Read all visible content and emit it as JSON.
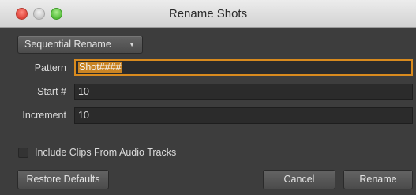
{
  "window": {
    "title": "Rename Shots"
  },
  "mode_dropdown": {
    "value": "Sequential Rename",
    "caret": "▼"
  },
  "fields": {
    "pattern": {
      "label": "Pattern",
      "value": "Shot####"
    },
    "start": {
      "label": "Start #",
      "value": "10"
    },
    "increment": {
      "label": "Increment",
      "value": "10"
    }
  },
  "options": {
    "include_audio_label": "Include Clips From Audio Tracks",
    "include_audio_checked": false
  },
  "buttons": {
    "restore_defaults": "Restore Defaults",
    "cancel": "Cancel",
    "rename": "Rename"
  },
  "colors": {
    "panel_bg": "#3d3d3d",
    "focus_border": "#d88a1e",
    "selection": "#c98424"
  }
}
